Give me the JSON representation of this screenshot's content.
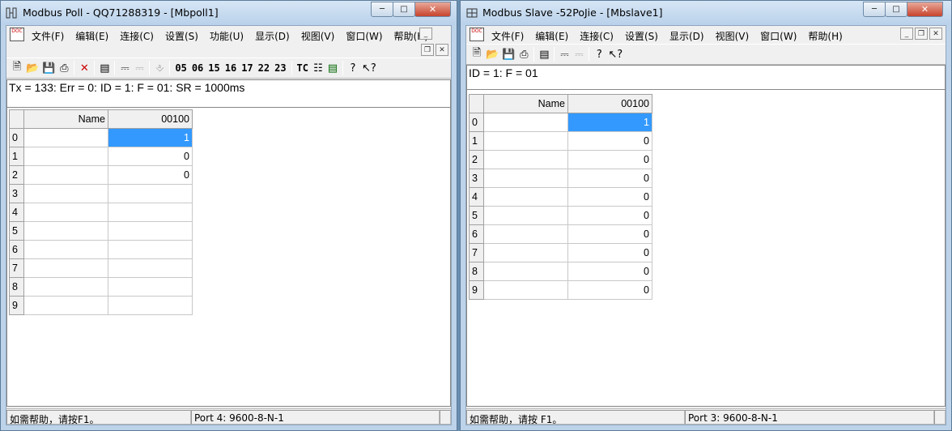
{
  "poll": {
    "title": "Modbus Poll - QQ71288319 - [Mbpoll1]",
    "menu": [
      "文件(F)",
      "编辑(E)",
      "连接(C)",
      "设置(S)",
      "功能(U)",
      "显示(D)",
      "视图(V)",
      "窗口(W)",
      "帮助(H)"
    ],
    "functions": [
      "05",
      "06",
      "15",
      "16",
      "17",
      "22",
      "23",
      "TC"
    ],
    "info": "Tx = 133: Err = 0: ID = 1: F = 01: SR = 1000ms",
    "header": {
      "name": "Name",
      "address": "00100"
    },
    "rows": [
      {
        "index": "0",
        "name": "",
        "value": "1"
      },
      {
        "index": "1",
        "name": "",
        "value": "0"
      },
      {
        "index": "2",
        "name": "",
        "value": "0"
      },
      {
        "index": "3",
        "name": "",
        "value": ""
      },
      {
        "index": "4",
        "name": "",
        "value": ""
      },
      {
        "index": "5",
        "name": "",
        "value": ""
      },
      {
        "index": "6",
        "name": "",
        "value": ""
      },
      {
        "index": "7",
        "name": "",
        "value": ""
      },
      {
        "index": "8",
        "name": "",
        "value": ""
      },
      {
        "index": "9",
        "name": "",
        "value": ""
      }
    ],
    "status_help": "如需帮助，请按F1。",
    "status_port": "Port 4: 9600-8-N-1"
  },
  "slave": {
    "title": "Modbus Slave -52PoJie - [Mbslave1]",
    "menu": [
      "文件(F)",
      "编辑(E)",
      "连接(C)",
      "设置(S)",
      "显示(D)",
      "视图(V)",
      "窗口(W)",
      "帮助(H)"
    ],
    "info": "ID = 1: F = 01",
    "header": {
      "name": "Name",
      "address": "00100"
    },
    "rows": [
      {
        "index": "0",
        "name": "",
        "value": "1"
      },
      {
        "index": "1",
        "name": "",
        "value": "0"
      },
      {
        "index": "2",
        "name": "",
        "value": "0"
      },
      {
        "index": "3",
        "name": "",
        "value": "0"
      },
      {
        "index": "4",
        "name": "",
        "value": "0"
      },
      {
        "index": "5",
        "name": "",
        "value": "0"
      },
      {
        "index": "6",
        "name": "",
        "value": "0"
      },
      {
        "index": "7",
        "name": "",
        "value": "0"
      },
      {
        "index": "8",
        "name": "",
        "value": "0"
      },
      {
        "index": "9",
        "name": "",
        "value": "0"
      }
    ],
    "status_help": "如需帮助，请按 F1。",
    "status_port": "Port 3: 9600-8-N-1"
  },
  "icons": {
    "doc_label": "DOC",
    "window_buttons": [
      "minimize-icon",
      "maximize-icon",
      "close-icon"
    ],
    "toolbar_poll": [
      "new-icon",
      "open-icon",
      "save-icon",
      "print-icon",
      "delete-icon",
      "window-icon",
      "connect-icon",
      "disconnect-icon",
      "pulse-icon"
    ],
    "toolbar_slave": [
      "new-icon",
      "open-icon",
      "save-icon",
      "print-icon",
      "window-icon",
      "connect-icon",
      "disconnect-icon",
      "help-icon",
      "context-help-icon"
    ]
  },
  "colors": {
    "selection": "#3399ff",
    "title_bar": "#bcd3ea",
    "close_button": "#c7432c"
  }
}
